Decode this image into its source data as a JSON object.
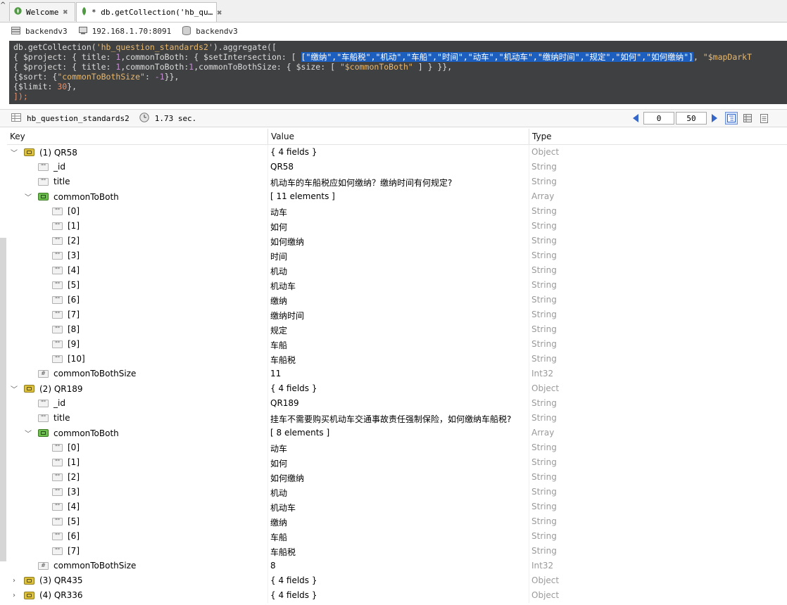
{
  "tabs": [
    {
      "label": "Welcome",
      "close": "✖"
    },
    {
      "label": "* db.getCollection('hb_qu…",
      "close": "✖"
    }
  ],
  "connection": {
    "connection_name": "backendv3",
    "server": "192.168.1.70:8091",
    "database": "backendv3"
  },
  "editor": {
    "line1": {
      "pre": "db.getCollection(",
      "str": "'hb_question_standards2'",
      "post": ").aggregate(["
    },
    "line2": {
      "pre": "{ $project: { title: ",
      "n1": "1",
      "mid": ",commonToBoth: { $setIntersection: [ ",
      "sel": "[\"缴纳\",\"车船税\",\"机动\",\"车船\",\"时间\",\"动车\",\"机动车\",\"缴纳时间\",\"规定\",\"如何\",\"如何缴纳\"]",
      "comma": ", ",
      "tail": "\"$mapDarkT"
    },
    "line3": {
      "pre": "{ $project: { title: ",
      "n1": "1",
      "mid": ",commonToBoth:",
      "n2": "1",
      "mid2": ",commonToBothSize: { $size: [ ",
      "str": "\"$commonToBoth\"",
      "post": " ] } }},"
    },
    "line4": {
      "pre": "{$sort: {",
      "str": "\"commonToBothSize\"",
      "mid": ": ",
      "num": "-1",
      "post": "}},"
    },
    "line5": {
      "pre": "{$limit: ",
      "num": "30",
      "post": "},"
    },
    "line6": {
      "text": "]);"
    }
  },
  "result_bar": {
    "collection": "hb_question_standards2",
    "time": "1.73 sec.",
    "page_start": "0",
    "page_size": "50"
  },
  "columns": {
    "key": "Key",
    "value": "Value",
    "type": "Type"
  },
  "rows": [
    {
      "toggle": "﹀",
      "icon": "object",
      "key": "(1) QR58",
      "value": "{ 4 fields }",
      "type": "Object",
      "indent": 0
    },
    {
      "toggle": "",
      "icon": "string",
      "key": "_id",
      "value": "QR58",
      "type": "String",
      "indent": 1
    },
    {
      "toggle": "",
      "icon": "string",
      "key": "title",
      "value": "机动车的车船税应如何缴纳？缴纳时间有何规定?",
      "type": "String",
      "indent": 1
    },
    {
      "toggle": "﹀",
      "icon": "array",
      "key": "commonToBoth",
      "value": "[ 11 elements ]",
      "type": "Array",
      "indent": 1
    },
    {
      "toggle": "",
      "icon": "string",
      "key": "[0]",
      "value": "动车",
      "type": "String",
      "indent": 2
    },
    {
      "toggle": "",
      "icon": "string",
      "key": "[1]",
      "value": "如何",
      "type": "String",
      "indent": 2
    },
    {
      "toggle": "",
      "icon": "string",
      "key": "[2]",
      "value": "如何缴纳",
      "type": "String",
      "indent": 2
    },
    {
      "toggle": "",
      "icon": "string",
      "key": "[3]",
      "value": "时间",
      "type": "String",
      "indent": 2
    },
    {
      "toggle": "",
      "icon": "string",
      "key": "[4]",
      "value": "机动",
      "type": "String",
      "indent": 2
    },
    {
      "toggle": "",
      "icon": "string",
      "key": "[5]",
      "value": "机动车",
      "type": "String",
      "indent": 2
    },
    {
      "toggle": "",
      "icon": "string",
      "key": "[6]",
      "value": "缴纳",
      "type": "String",
      "indent": 2
    },
    {
      "toggle": "",
      "icon": "string",
      "key": "[7]",
      "value": "缴纳时间",
      "type": "String",
      "indent": 2
    },
    {
      "toggle": "",
      "icon": "string",
      "key": "[8]",
      "value": "规定",
      "type": "String",
      "indent": 2
    },
    {
      "toggle": "",
      "icon": "string",
      "key": "[9]",
      "value": "车船",
      "type": "String",
      "indent": 2
    },
    {
      "toggle": "",
      "icon": "string",
      "key": "[10]",
      "value": "车船税",
      "type": "String",
      "indent": 2
    },
    {
      "toggle": "",
      "icon": "int",
      "key": "commonToBothSize",
      "value": "11",
      "type": "Int32",
      "indent": 1
    },
    {
      "toggle": "﹀",
      "icon": "object",
      "key": "(2) QR189",
      "value": "{ 4 fields }",
      "type": "Object",
      "indent": 0
    },
    {
      "toggle": "",
      "icon": "string",
      "key": "_id",
      "value": "QR189",
      "type": "String",
      "indent": 1
    },
    {
      "toggle": "",
      "icon": "string",
      "key": "title",
      "value": "挂车不需要购买机动车交通事故责任强制保险，如何缴纳车船税?",
      "type": "String",
      "indent": 1
    },
    {
      "toggle": "﹀",
      "icon": "array",
      "key": "commonToBoth",
      "value": "[ 8 elements ]",
      "type": "Array",
      "indent": 1
    },
    {
      "toggle": "",
      "icon": "string",
      "key": "[0]",
      "value": "动车",
      "type": "String",
      "indent": 2
    },
    {
      "toggle": "",
      "icon": "string",
      "key": "[1]",
      "value": "如何",
      "type": "String",
      "indent": 2
    },
    {
      "toggle": "",
      "icon": "string",
      "key": "[2]",
      "value": "如何缴纳",
      "type": "String",
      "indent": 2
    },
    {
      "toggle": "",
      "icon": "string",
      "key": "[3]",
      "value": "机动",
      "type": "String",
      "indent": 2
    },
    {
      "toggle": "",
      "icon": "string",
      "key": "[4]",
      "value": "机动车",
      "type": "String",
      "indent": 2
    },
    {
      "toggle": "",
      "icon": "string",
      "key": "[5]",
      "value": "缴纳",
      "type": "String",
      "indent": 2
    },
    {
      "toggle": "",
      "icon": "string",
      "key": "[6]",
      "value": "车船",
      "type": "String",
      "indent": 2
    },
    {
      "toggle": "",
      "icon": "string",
      "key": "[7]",
      "value": "车船税",
      "type": "String",
      "indent": 2
    },
    {
      "toggle": "",
      "icon": "int",
      "key": "commonToBothSize",
      "value": "8",
      "type": "Int32",
      "indent": 1
    },
    {
      "toggle": "›",
      "icon": "object",
      "key": "(3) QR435",
      "value": "{ 4 fields }",
      "type": "Object",
      "indent": 0
    },
    {
      "toggle": "›",
      "icon": "object",
      "key": "(4) QR336",
      "value": "{ 4 fields }",
      "type": "Object",
      "indent": 0
    }
  ]
}
